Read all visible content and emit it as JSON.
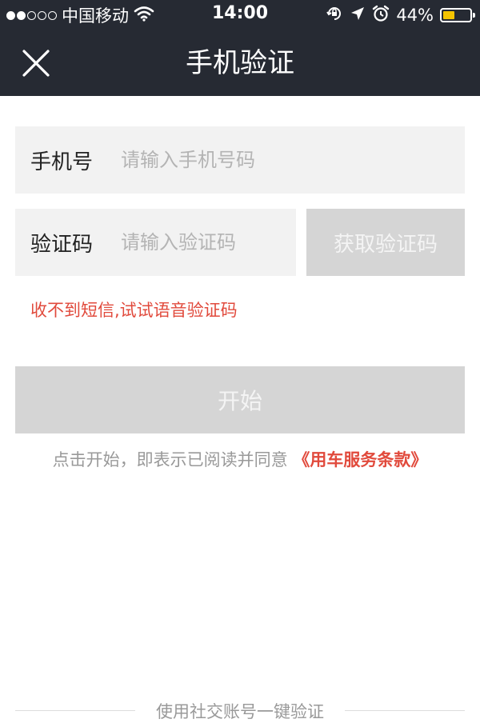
{
  "status_bar": {
    "carrier": "中国移动",
    "time": "14:00",
    "battery_percent": "44%",
    "battery_level": 0.44,
    "signal_bars_filled": 2,
    "signal_bars_total": 5,
    "icons": [
      "wifi-icon",
      "orientation-lock-icon",
      "location-arrow-icon",
      "alarm-icon",
      "battery-icon"
    ]
  },
  "nav": {
    "title": "手机验证",
    "close_icon": "close-icon"
  },
  "form": {
    "phone_label": "手机号",
    "phone_placeholder": "请输入手机号码",
    "phone_value": "",
    "code_label": "验证码",
    "code_placeholder": "请输入验证码",
    "code_value": "",
    "get_code_label": "获取验证码",
    "voice_code_link": "收不到短信,试试语音验证码",
    "start_label": "开始",
    "agreement_text": "点击开始，即表示已阅读并同意",
    "terms_link": "《用车服务条款》"
  },
  "social": {
    "divider_label": "使用社交账号一键验证"
  },
  "colors": {
    "header_bg": "#262a33",
    "field_bg": "#f2f2f2",
    "disabled_button": "#d5d5d5",
    "accent_red": "#e14a3c",
    "battery_fill": "#f5c400"
  }
}
